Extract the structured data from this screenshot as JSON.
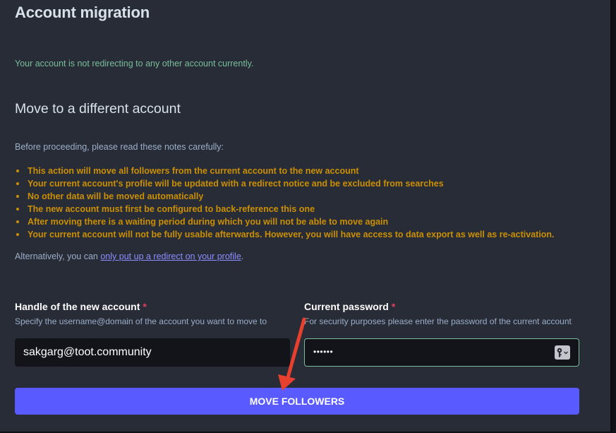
{
  "page": {
    "title": "Account migration",
    "status_message": "Your account is not redirecting to any other account currently."
  },
  "move_section": {
    "title": "Move to a different account",
    "intro": "Before proceeding, please read these notes carefully:",
    "notes": [
      "This action will move all followers from the current account to the new account",
      "Your current account's profile will be updated with a redirect notice and be excluded from searches",
      "No other data will be moved automatically",
      "The new account must first be configured to back-reference this one",
      "After moving there is a waiting period during which you will not be able to move again",
      "Your current account will not be fully usable afterwards. However, you will have access to data export as well as re-activation."
    ],
    "alternative_prefix": "Alternatively, you can ",
    "alternative_link": "only put up a redirect on your profile",
    "alternative_suffix": "."
  },
  "form": {
    "handle": {
      "label": "Handle of the new account",
      "required_mark": "*",
      "hint": "Specify the username@domain of the account you want to move to",
      "value": "sakgarg@toot.community"
    },
    "password": {
      "label": "Current password",
      "required_mark": "*",
      "hint": "For security purposes please enter the password of the current account",
      "masked_value": "••••••"
    },
    "submit_label": "MOVE FOLLOWERS"
  },
  "annotation": {
    "arrow_color": "#e8402f"
  },
  "colors": {
    "background": "#282c37",
    "status_success": "#79bd9a",
    "warning": "#ca8f04",
    "link": "#8c8dff",
    "required": "#df405a",
    "button": "#595aff",
    "input_focus_border": "#79bd9a"
  }
}
